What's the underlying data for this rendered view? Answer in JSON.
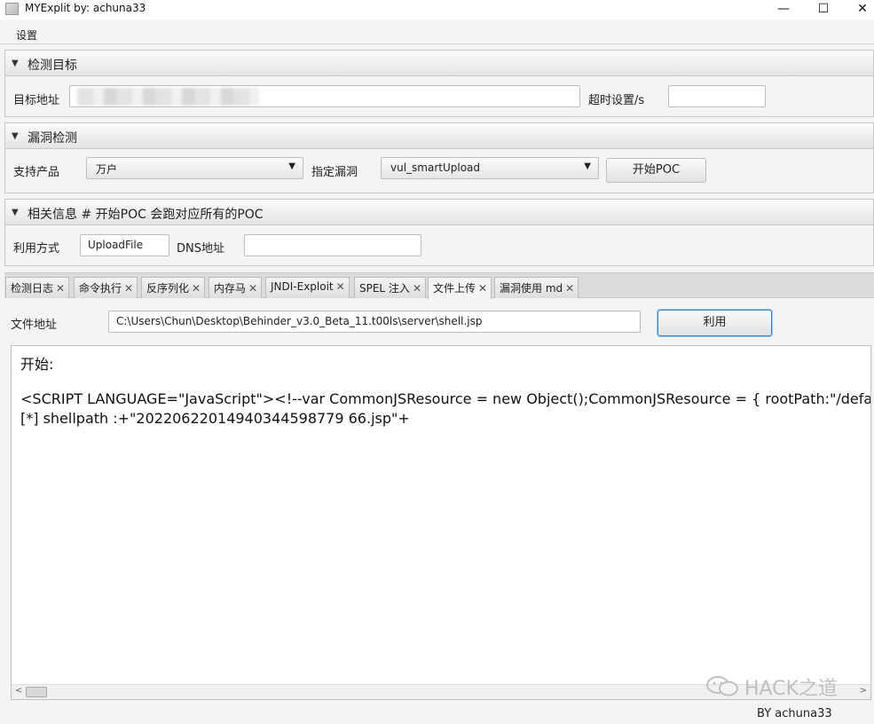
{
  "window": {
    "title": "MYExplit by: achuna33",
    "minimize": "—",
    "maximize": "☐",
    "close": "✕"
  },
  "menu": {
    "settings": "设置"
  },
  "target_section": {
    "header": "检测目标",
    "target_label": "目标地址",
    "target_value": "",
    "timeout_label": "超时设置/s",
    "timeout_value": ""
  },
  "vuln_section": {
    "header": "漏洞检测",
    "product_label": "支持产品",
    "product_value": "万户",
    "vuln_label": "指定漏洞",
    "vuln_value": "vul_smartUpload",
    "start_button": "开始POC"
  },
  "info_section": {
    "header": "相关信息 # 开始POC 会跑对应所有的POC",
    "method_label": "利用方式",
    "method_value": "UploadFile",
    "dns_label": "DNS地址",
    "dns_value": ""
  },
  "tabs": [
    {
      "label": "检测日志",
      "close": "✕"
    },
    {
      "label": "命令执行",
      "close": "✕"
    },
    {
      "label": "反序列化",
      "close": "✕"
    },
    {
      "label": "内存马",
      "close": "✕"
    },
    {
      "label": "JNDI-Exploit",
      "close": "✕"
    },
    {
      "label": "SPEL 注入",
      "close": "✕"
    },
    {
      "label": "文件上传",
      "close": "✕"
    },
    {
      "label": "漏洞使用 md",
      "close": "✕"
    }
  ],
  "active_tab": "文件上传",
  "upload": {
    "file_label": "文件地址",
    "file_path": "C:\\Users\\Chun\\Desktop\\Behinder_v3.0_Beta_11.t00ls\\server\\shell.jsp",
    "exploit_button": "利用"
  },
  "output": {
    "lines": [
      "开始:",
      "",
      "<SCRIPT LANGUAGE=\"JavaScript\"><!--var CommonJSResource = new Object();CommonJSResource = {  rootPath:\"/defaultro",
      "[*] shellpath :+\"20220622014940344598779 66.jsp\"+"
    ]
  },
  "watermark": "HACK之道",
  "footer": "BY   achuna33"
}
